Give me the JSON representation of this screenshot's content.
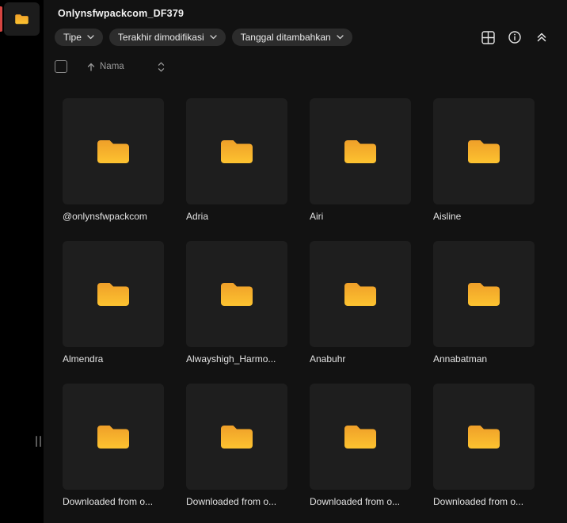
{
  "window": {
    "title": "Onlynsfwpackcom_DF379"
  },
  "sidebar": {
    "active_item": "current-folder"
  },
  "toolbar": {
    "filters": [
      {
        "label": "Tipe"
      },
      {
        "label": "Terakhir dimodifikasi"
      },
      {
        "label": "Tanggal ditambahkan"
      }
    ],
    "icons": [
      "grid-view",
      "info",
      "collapse-all"
    ]
  },
  "list_controls": {
    "sort_field": "Nama"
  },
  "folders": [
    {
      "name": "@onlynsfwpackcom"
    },
    {
      "name": "Adria"
    },
    {
      "name": "Airi"
    },
    {
      "name": "Aisline"
    },
    {
      "name": "Almendra"
    },
    {
      "name": "Alwayshigh_Harmo..."
    },
    {
      "name": "Anabuhr"
    },
    {
      "name": "Annabatman"
    },
    {
      "name": "Downloaded from o..."
    },
    {
      "name": "Downloaded from o..."
    },
    {
      "name": "Downloaded from o..."
    },
    {
      "name": "Downloaded from o..."
    }
  ],
  "colors": {
    "background": "#121212",
    "sidebar": "#000000",
    "card": "#1e1e1e",
    "chip": "#2c2c2c",
    "accent": "#d64541",
    "folder_top": "#ef9f29",
    "folder_bottom": "#fdc330"
  }
}
